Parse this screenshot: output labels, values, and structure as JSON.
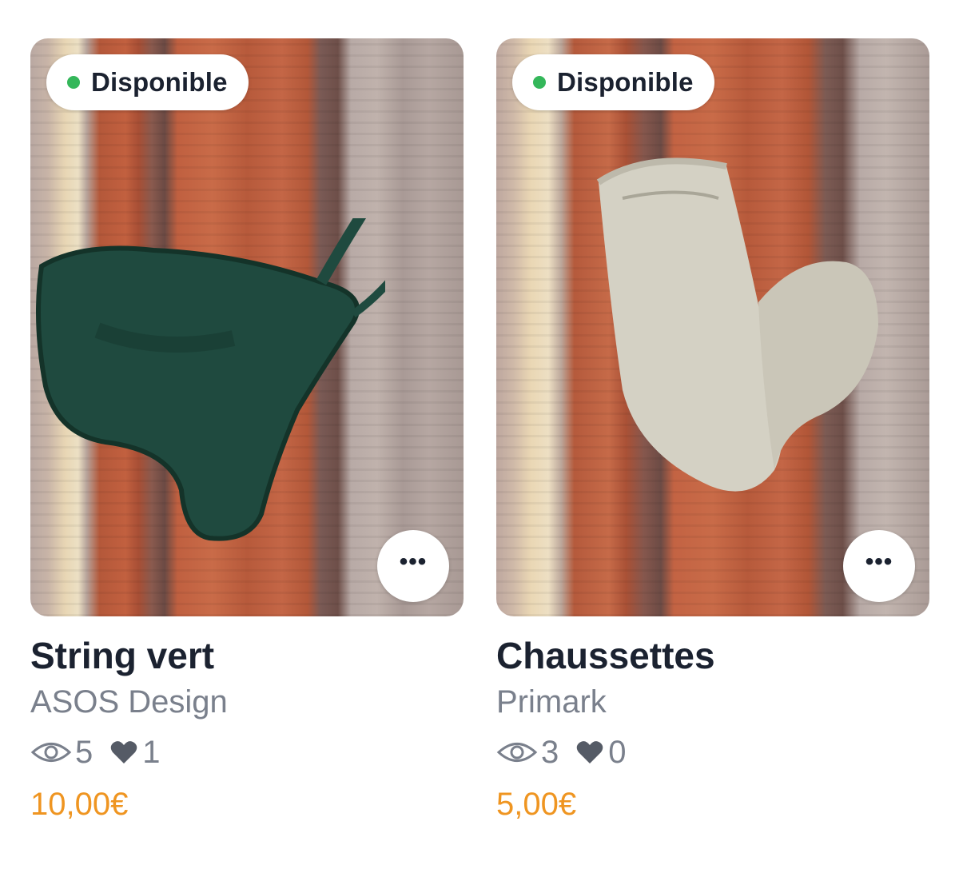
{
  "listings": [
    {
      "status": "Disponible",
      "status_color": "#34b75a",
      "title": "String vert",
      "brand": "ASOS Design",
      "views": "5",
      "likes": "1",
      "price": "10,00€",
      "more_icon": "ellipsis-icon"
    },
    {
      "status": "Disponible",
      "status_color": "#34b75a",
      "title": "Chaussettes",
      "brand": "Primark",
      "views": "3",
      "likes": "0",
      "price": "5,00€",
      "more_icon": "ellipsis-icon"
    }
  ],
  "colors": {
    "price": "#ef9521",
    "title": "#1b2230",
    "secondary": "#7a808c"
  }
}
